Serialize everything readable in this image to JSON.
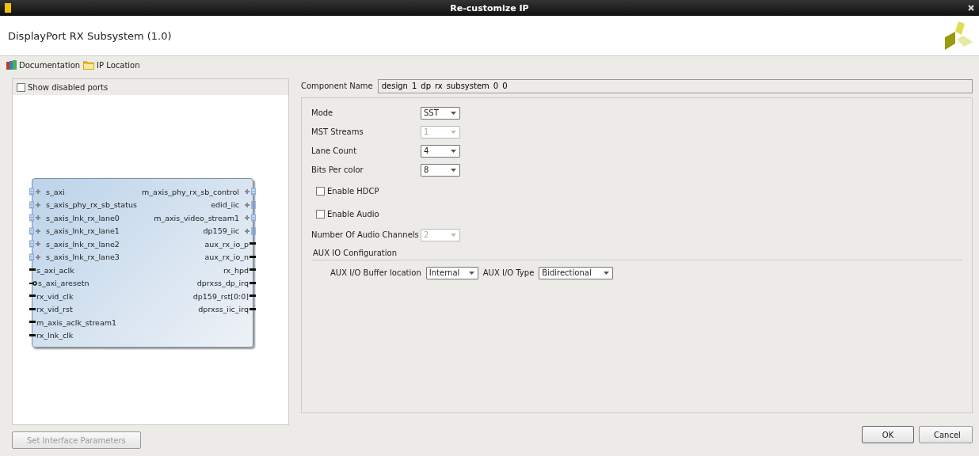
{
  "window": {
    "title": "Re-customize IP"
  },
  "header": {
    "title": "DisplayPort RX Subsystem (1.0)"
  },
  "links": [
    {
      "label": "Documentation",
      "kind": "book"
    },
    {
      "label": "IP Location",
      "kind": "folder"
    }
  ],
  "symbol_panel": {
    "show_disabled_ports": {
      "label": "Show disabled ports",
      "checked": false
    },
    "left_ports": [
      {
        "name": "s_axi",
        "kind": "bus"
      },
      {
        "name": "s_axis_phy_rx_sb_status",
        "kind": "bus"
      },
      {
        "name": "s_axis_lnk_rx_lane0",
        "kind": "bus"
      },
      {
        "name": "s_axis_lnk_rx_lane1",
        "kind": "bus"
      },
      {
        "name": "s_axis_lnk_rx_lane2",
        "kind": "bus"
      },
      {
        "name": "s_axis_lnk_rx_lane3",
        "kind": "bus"
      },
      {
        "name": "s_axi_aclk",
        "kind": "wire"
      },
      {
        "name": "s_axi_aresetn",
        "kind": "reset"
      },
      {
        "name": "rx_vid_clk",
        "kind": "wire"
      },
      {
        "name": "rx_vid_rst",
        "kind": "wire"
      },
      {
        "name": "m_axis_aclk_stream1",
        "kind": "wire"
      },
      {
        "name": "rx_lnk_clk",
        "kind": "wire"
      }
    ],
    "right_ports": [
      {
        "name": "m_axis_phy_rx_sb_control",
        "kind": "bus"
      },
      {
        "name": "edid_iic",
        "kind": "iic"
      },
      {
        "name": "m_axis_video_stream1",
        "kind": "bus"
      },
      {
        "name": "dp159_iic",
        "kind": "iic"
      },
      {
        "name": "aux_rx_io_p",
        "kind": "wire"
      },
      {
        "name": "aux_rx_io_n",
        "kind": "wire"
      },
      {
        "name": "rx_hpd",
        "kind": "wire"
      },
      {
        "name": "dprxss_dp_irq",
        "kind": "wire"
      },
      {
        "name": "dp159_rst[0:0]",
        "kind": "wire"
      },
      {
        "name": "dprxss_iic_irq",
        "kind": "wire"
      }
    ],
    "button": {
      "label": "Set Interface Parameters",
      "disabled": true
    }
  },
  "config": {
    "component_name": {
      "label": "Component Name",
      "value": "design_1_dp_rx_subsystem_0_0"
    },
    "params": [
      {
        "kind": "select",
        "label": "Mode",
        "value": "SST",
        "disabled": false
      },
      {
        "kind": "select",
        "label": "MST Streams",
        "value": "1",
        "disabled": true
      },
      {
        "kind": "select",
        "label": "Lane Count",
        "value": "4",
        "disabled": false
      },
      {
        "kind": "select",
        "label": "Bits Per color",
        "value": "8",
        "disabled": false
      },
      {
        "kind": "checkbox",
        "label": "Enable HDCP",
        "checked": false
      },
      {
        "kind": "checkbox",
        "label": "Enable Audio",
        "checked": false
      },
      {
        "kind": "select",
        "label": "Number Of Audio Channels",
        "value": "2",
        "disabled": true
      }
    ],
    "aux": {
      "title": "AUX IO Configuration",
      "fields": [
        {
          "label": "AUX I/O Buffer location",
          "value": "Internal"
        },
        {
          "label": "AUX I/O Type",
          "value": "Bidirectional"
        }
      ]
    }
  },
  "buttons": [
    {
      "label": "OK",
      "default": true
    },
    {
      "label": "Cancel",
      "default": false
    }
  ]
}
